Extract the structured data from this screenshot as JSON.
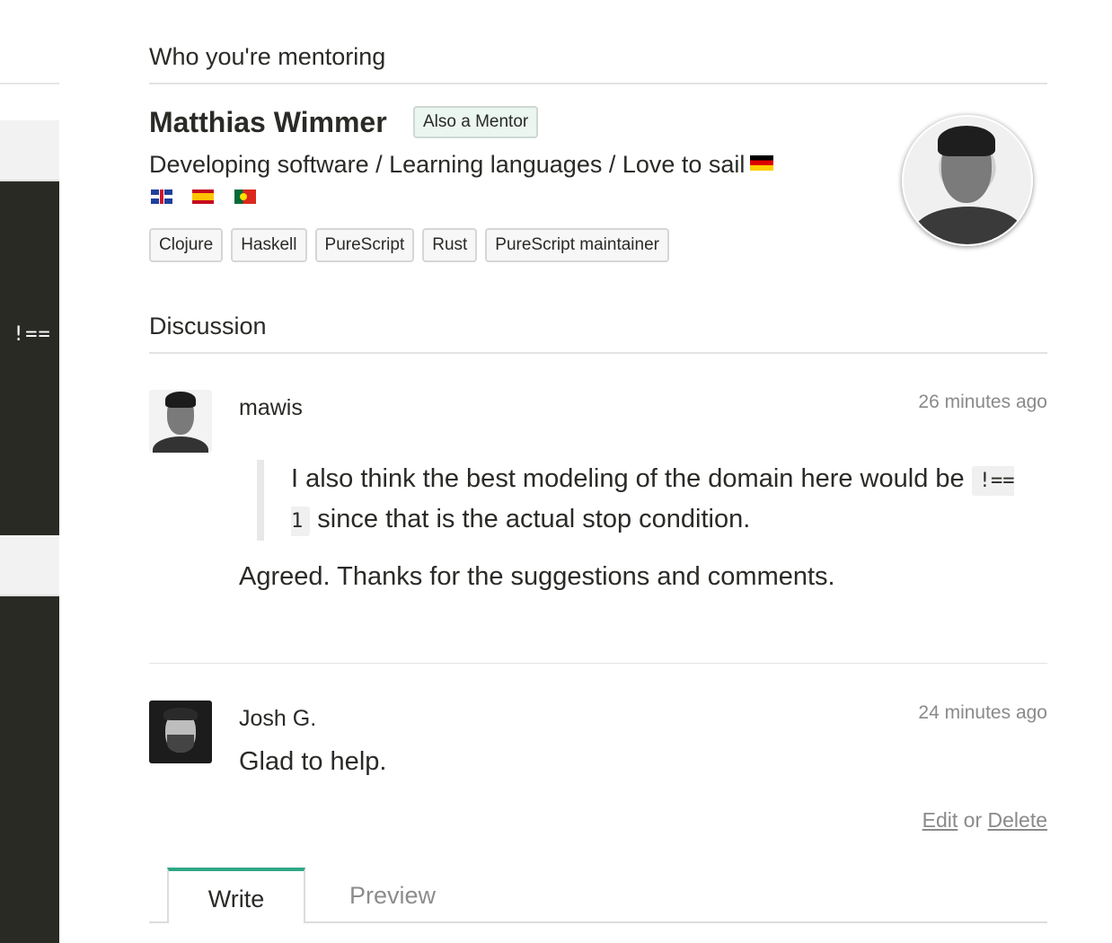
{
  "code_strip": {
    "snippet": "!=="
  },
  "mentee": {
    "section_title": "Who you're mentoring",
    "name": "Matthias Wimmer",
    "badge": "Also a Mentor",
    "bio": "Developing software / Learning languages / Love to sail",
    "bio_flag": "flag-germany",
    "language_flags": [
      "flag-uk",
      "flag-spain",
      "flag-portugal"
    ],
    "tags": [
      "Clojure",
      "Haskell",
      "PureScript",
      "Rust",
      "PureScript maintainer"
    ]
  },
  "discussion": {
    "section_title": "Discussion",
    "posts": [
      {
        "author": "mawis",
        "timestamp": "26 minutes ago",
        "quote_before": "I also think the best modeling of the domain here would be ",
        "quote_code": "!== 1",
        "quote_after": " since that is the actual stop condition.",
        "text": "Agreed. Thanks for the suggestions and comments."
      },
      {
        "author": "Josh G.",
        "timestamp": "24 minutes ago",
        "text": "Glad to help."
      }
    ],
    "actions": {
      "edit": "Edit",
      "or": "or",
      "delete": "Delete"
    }
  },
  "editor": {
    "tabs": [
      {
        "label": "Write",
        "active": true
      },
      {
        "label": "Preview",
        "active": false
      }
    ],
    "accent_color": "#2fa786"
  }
}
